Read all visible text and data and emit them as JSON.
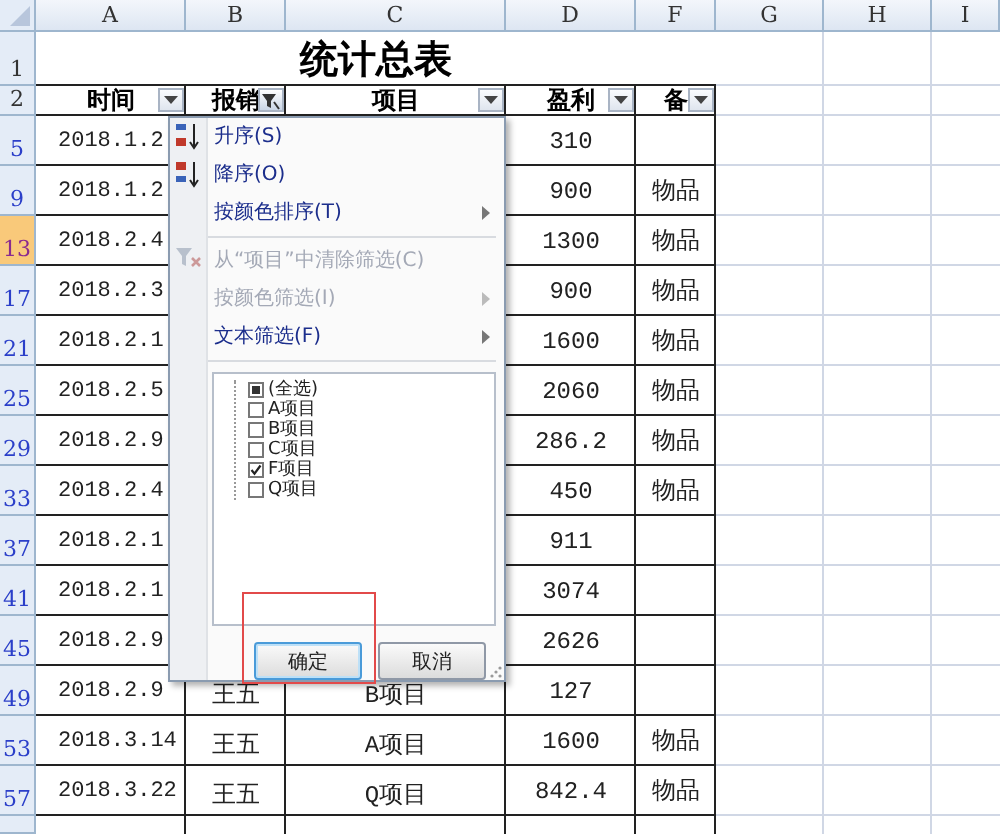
{
  "column_letters": [
    {
      "label": "A",
      "selected": false
    },
    {
      "label": "B",
      "selected": false
    },
    {
      "label": "C",
      "selected": false
    },
    {
      "label": "D",
      "selected": false
    },
    {
      "label": "F",
      "selected": false
    },
    {
      "label": "G",
      "selected": false
    },
    {
      "label": "H",
      "selected": false
    },
    {
      "label": "I",
      "selected": false
    }
  ],
  "title_row": {
    "row": "1",
    "title": "统计总表"
  },
  "header_row": {
    "row": "2",
    "headers": [
      {
        "label": "时间",
        "filtered": false
      },
      {
        "label": "报销",
        "filtered": true
      },
      {
        "label": "项目",
        "filtered": false
      },
      {
        "label": "盈利",
        "filtered": false
      },
      {
        "label": "备",
        "filtered": false
      }
    ]
  },
  "rows": [
    {
      "row": "5",
      "selected": false,
      "time": "2018.1.2",
      "profit": "310"
    },
    {
      "row": "9",
      "selected": false,
      "time": "2018.1.2",
      "profit": "900",
      "note": "物品"
    },
    {
      "row": "13",
      "selected": true,
      "time": "2018.2.4",
      "profit": "1300",
      "note": "物品"
    },
    {
      "row": "17",
      "selected": false,
      "time": "2018.2.3",
      "profit": "900",
      "note": "物品"
    },
    {
      "row": "21",
      "selected": false,
      "time": "2018.2.1",
      "profit": "1600",
      "note": "物品"
    },
    {
      "row": "25",
      "selected": false,
      "time": "2018.2.5",
      "profit": "2060",
      "note": "物品"
    },
    {
      "row": "29",
      "selected": false,
      "time": "2018.2.9",
      "profit": "286.2",
      "note": "物品"
    },
    {
      "row": "33",
      "selected": false,
      "time": "2018.2.4",
      "profit": "450",
      "note": "物品"
    },
    {
      "row": "37",
      "selected": false,
      "time": "2018.2.1",
      "profit": "911"
    },
    {
      "row": "41",
      "selected": false,
      "time": "2018.2.1",
      "profit": "3074"
    },
    {
      "row": "45",
      "selected": false,
      "time": "2018.2.9",
      "profit": "2626"
    },
    {
      "row": "49",
      "selected": false,
      "time": "2018.2.9",
      "person": "王五",
      "project": "B项目",
      "profit": "127"
    },
    {
      "row": "53",
      "selected": false,
      "time": "2018.3.14",
      "person": "王五",
      "project": "A项目",
      "profit": "1600",
      "note": "物品"
    },
    {
      "row": "57",
      "selected": false,
      "time": "2018.3.22",
      "person": "王五",
      "project": "Q项目",
      "profit": "842.4",
      "note": "物品"
    }
  ],
  "filter_popup": {
    "menu": [
      {
        "kind": "sort_asc",
        "label": "升序(S)",
        "disabled": false,
        "submenu": false
      },
      {
        "kind": "sort_desc",
        "label": "降序(O)",
        "disabled": false,
        "submenu": false
      },
      {
        "kind": "plain",
        "label": "按颜色排序(T)",
        "disabled": false,
        "submenu": true
      },
      {
        "kind": "separator"
      },
      {
        "kind": "clear",
        "label": "从“项目”中清除筛选(C)",
        "disabled": true,
        "submenu": false
      },
      {
        "kind": "plain",
        "label": "按颜色筛选(I)",
        "disabled": true,
        "submenu": true
      },
      {
        "kind": "plain",
        "label": "文本筛选(F)",
        "disabled": false,
        "submenu": true
      },
      {
        "kind": "separator"
      }
    ],
    "values": [
      {
        "label": "(全选)",
        "checked": false,
        "indeterminate": true
      },
      {
        "label": "A项目",
        "checked": false,
        "indeterminate": false
      },
      {
        "label": "B项目",
        "checked": false,
        "indeterminate": false
      },
      {
        "label": "C项目",
        "checked": false,
        "indeterminate": false
      },
      {
        "label": "F项目",
        "checked": true,
        "indeterminate": false
      },
      {
        "label": "Q项目",
        "checked": false,
        "indeterminate": false
      }
    ],
    "buttons": [
      {
        "label": "确定",
        "highlighted": true
      },
      {
        "label": "取消",
        "highlighted": false
      }
    ]
  }
}
